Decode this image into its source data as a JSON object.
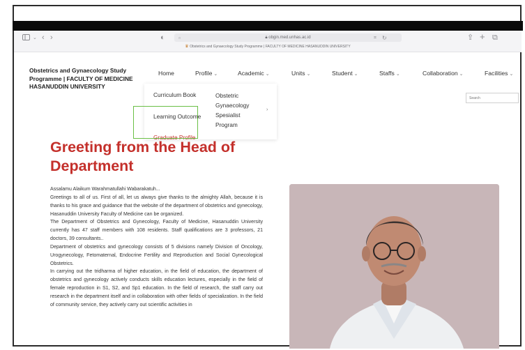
{
  "browser": {
    "url": "obgin.med.unhas.ac.id",
    "tab_title": "Obstetrics and Gynaecology Study Programme | FACULTY OF MEDICINE HASANUDDIN UNIVERSITY",
    "icons": [
      "sidebar-icon",
      "chevron-down-icon",
      "back-icon",
      "forward-icon",
      "shield-icon",
      "page-icon",
      "lock-icon",
      "translate-icon",
      "reload-icon",
      "share-icon",
      "new-tab-icon",
      "tabs-icon"
    ]
  },
  "site": {
    "brand": "Obstetrics and Gynaecology Study Programme | FACULTY OF MEDICINE HASANUDDIN UNIVERSITY",
    "nav": [
      {
        "label": "Home",
        "has_dropdown": false
      },
      {
        "label": "Profile",
        "has_dropdown": true
      },
      {
        "label": "Academic",
        "has_dropdown": true
      },
      {
        "label": "Units",
        "has_dropdown": true
      },
      {
        "label": "Student",
        "has_dropdown": true
      },
      {
        "label": "Staffs",
        "has_dropdown": true
      },
      {
        "label": "Collaboration",
        "has_dropdown": true
      },
      {
        "label": "Facilities",
        "has_dropdown": true
      }
    ],
    "search_placeholder": "Search",
    "dropdown": {
      "items": [
        "Curriculum Book",
        "Learning Outcome",
        "Graduate Profile"
      ],
      "submenu": [
        "Obstetric",
        "Gynaecology",
        "Spesialist",
        "Program"
      ]
    }
  },
  "main": {
    "heading_line1": "Greeting from the Head of",
    "heading_line2": "Department",
    "paragraphs": [
      "Assalamu Alaikum Warahmatullahi Wabarakatuh...",
      "Greetings to all of us. First of all, let us always give thanks to the almighty Allah, because it is thanks to his grace and guidance that the website of the department of obstetrics and gynecology, Hasanuddin University Faculty of Medicine can be organized.",
      "The Department of Obstetrics and Gynecology, Faculty of Medicine, Hasanuddin University currently has 47 staff members with 108 residents. Staff qualifications are 3 professors, 21 doctors, 39 consultants..",
      "Department of obstetrics and gynecology consists of 5 divisions namely Division of Oncology, Urogynecology, Fetomaternal, Endocrine Fertility and Reproduction and Social Gynecological Obstetrics.",
      "In carrying out the tridharma of higher education, in the field of education, the department of obstetrics and gynecology actively conducts skills education lectures, especially in the field of female reproduction in S1, S2, and Sp1 education. In the field of research, the staff carry out research in the department itself and in collaboration with other fields of specialization. In the field of community service, they actively carry out scientific activities in"
    ]
  },
  "colors": {
    "accent_red": "#c4302b",
    "photo_background": "#c8b6b8",
    "highlight_green": "#6abf45"
  }
}
